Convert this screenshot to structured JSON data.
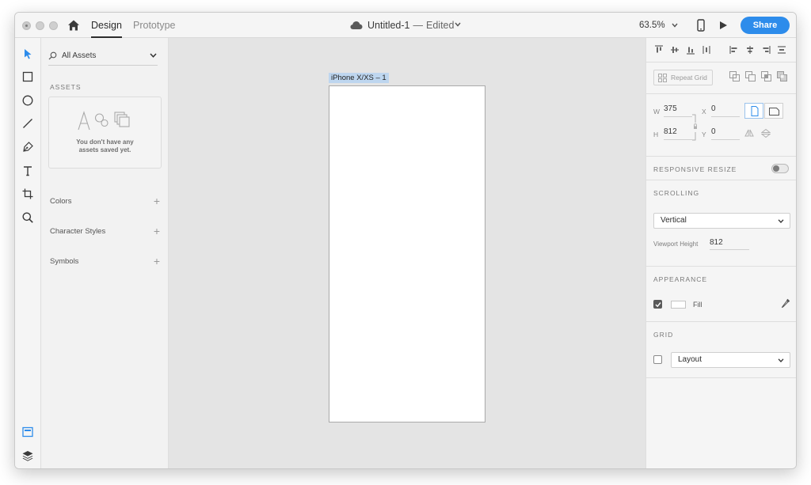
{
  "titlebar": {
    "tabs": {
      "design": "Design",
      "prototype": "Prototype"
    },
    "doc_name": "Untitled-1",
    "doc_separator": "—",
    "doc_state": "Edited",
    "zoom": "63.5%",
    "share_label": "Share"
  },
  "toolbar": {
    "tools": [
      "select-tool-icon",
      "rectangle-tool-icon",
      "ellipse-tool-icon",
      "line-tool-icon",
      "pen-tool-icon",
      "text-tool-icon",
      "artboard-tool-icon",
      "zoom-tool-icon"
    ],
    "bottom": [
      "assets-panel-icon",
      "layers-panel-icon"
    ]
  },
  "assets": {
    "filter": "All Assets",
    "section_title": "ASSETS",
    "empty_line1": "You don't have any",
    "empty_line2": "assets saved yet.",
    "rows": [
      {
        "label": "Colors",
        "action": "+"
      },
      {
        "label": "Character Styles",
        "action": "+"
      },
      {
        "label": "Symbols",
        "action": "+"
      }
    ]
  },
  "canvas": {
    "artboard_name": "iPhone X/XS – 1"
  },
  "inspector": {
    "repeat_grid": "Repeat Grid",
    "w_label": "W",
    "w_value": "375",
    "h_label": "H",
    "h_value": "812",
    "x_label": "X",
    "x_value": "0",
    "y_label": "Y",
    "y_value": "0",
    "responsive_resize": "RESPONSIVE RESIZE",
    "scrolling": "SCROLLING",
    "scroll_mode": "Vertical",
    "viewport_label": "Viewport Height",
    "viewport_value": "812",
    "appearance": "APPEARANCE",
    "fill_label": "Fill",
    "grid": "GRID",
    "grid_mode": "Layout"
  },
  "colors": {
    "accent": "#2d8ceb",
    "selection": "#bed6ef",
    "canvas": "#e4e4e4"
  }
}
